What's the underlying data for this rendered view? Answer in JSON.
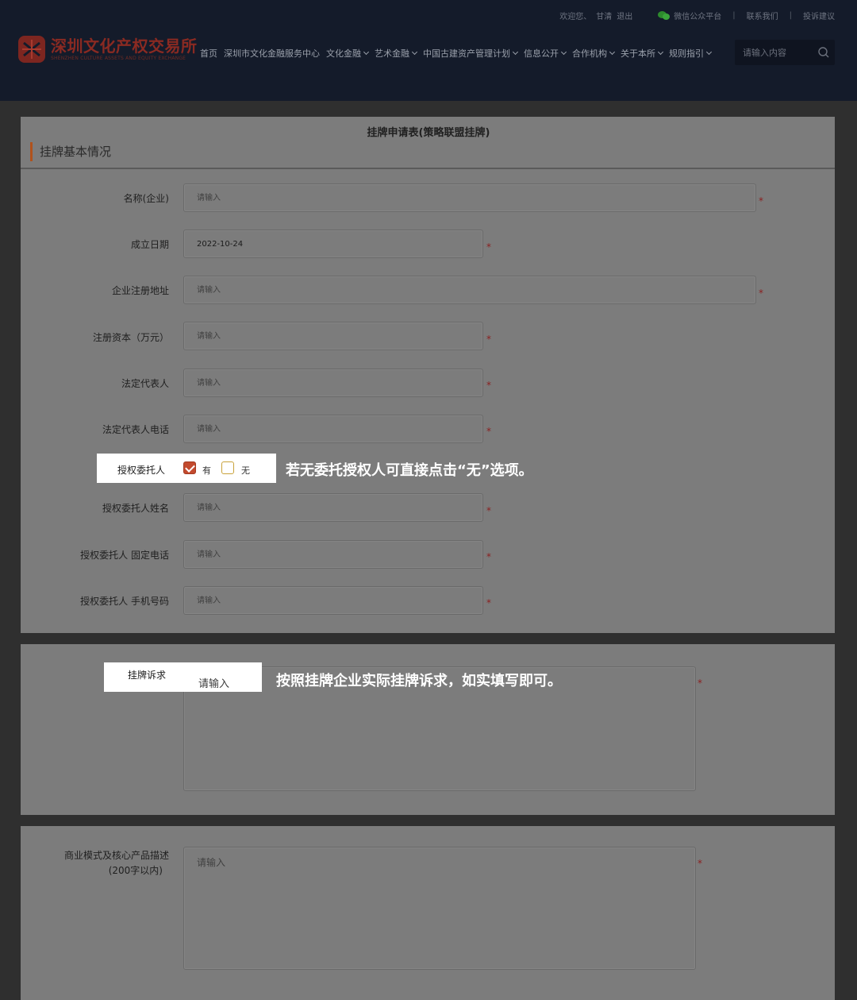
{
  "topbar": {
    "welcome": "欢迎您、",
    "user": "甘清",
    "logout": "退出",
    "wechat": "微信公众平台",
    "sep": "|",
    "contact": "联系我们",
    "complaint": "投诉建议"
  },
  "logo": {
    "name_cn": "深圳文化产权交易所",
    "name_en": "SHENZHEN CULTURE ASSETS AND EQUITY EXCHANGE",
    "brand_color": "#8a2a22"
  },
  "nav": {
    "items": [
      {
        "label": "首页",
        "dropdown": false
      },
      {
        "label": "深圳市文化金融服务中心",
        "dropdown": false
      },
      {
        "label": "文化金融",
        "dropdown": true
      },
      {
        "label": "艺术金融",
        "dropdown": true
      },
      {
        "label": "中国古建资产管理计划",
        "dropdown": true
      },
      {
        "label": "信息公开",
        "dropdown": true
      },
      {
        "label": "合作机构",
        "dropdown": true
      },
      {
        "label": "关于本所",
        "dropdown": true
      },
      {
        "label": "规则指引",
        "dropdown": true
      }
    ]
  },
  "search": {
    "placeholder": "请输入内容",
    "icon": "search-icon"
  },
  "form": {
    "title": "挂牌申请表(策略联盟挂牌)",
    "section": "挂牌基本情况",
    "required_mark": "*",
    "placeholder": "请输入",
    "fields": {
      "company_name": {
        "label": "名称(企业)",
        "value": ""
      },
      "founded_date": {
        "label": "成立日期",
        "value": "2022-10-24"
      },
      "reg_address": {
        "label": "企业注册地址",
        "value": ""
      },
      "reg_capital": {
        "label": "注册资本（万元）",
        "value": ""
      },
      "legal_rep": {
        "label": "法定代表人",
        "value": ""
      },
      "legal_rep_phone": {
        "label": "法定代表人电话",
        "value": ""
      },
      "authorized": {
        "label": "授权委托人",
        "option_yes": "有",
        "option_no": "无",
        "selected": "有"
      },
      "agent_name": {
        "label": "授权委托人姓名",
        "value": ""
      },
      "agent_tel": {
        "label": "授权委托人 固定电话",
        "value": ""
      },
      "agent_mobile": {
        "label": "授权委托人 手机号码",
        "value": ""
      },
      "listing_demand": {
        "label": "挂牌诉求",
        "value": ""
      },
      "business_desc": {
        "label_line1": "商业模式及核心产品描述",
        "label_line2": "(200字以内)",
        "value": ""
      }
    }
  },
  "tips": {
    "authorized": "若无委托授权人可直接点击“无”选项。",
    "demand": "按照挂牌企业实际挂牌诉求，如实填写即可。"
  },
  "colors": {
    "accent": "#b0521c",
    "checkbox_on": "#c34a2e",
    "required": "#8b1e1e",
    "header_bg": "#141b2a"
  }
}
